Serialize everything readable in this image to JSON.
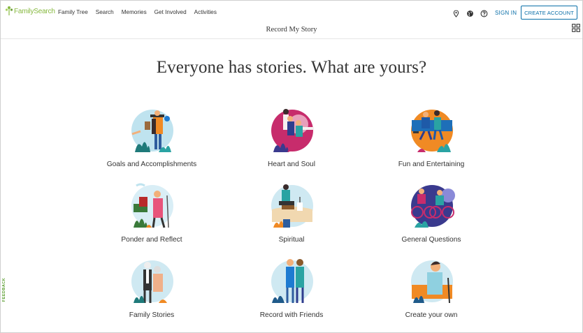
{
  "brand": {
    "name": "FamilySearch",
    "color": "#87b940"
  },
  "nav": [
    "Family Tree",
    "Search",
    "Memories",
    "Get Involved",
    "Activities"
  ],
  "header_icons": [
    "location-pin-icon",
    "globe-icon",
    "help-icon"
  ],
  "sign_in": "SIGN IN",
  "create_account": "CREATE ACCOUNT",
  "page_subtitle": "Record My Story",
  "headline": "Everyone has stories. What are yours?",
  "topics": [
    {
      "label": "Goals and Accomplishments",
      "icon": "goals-illustration"
    },
    {
      "label": "Heart and Soul",
      "icon": "heart-illustration"
    },
    {
      "label": "Fun and Entertaining",
      "icon": "fun-illustration"
    },
    {
      "label": "Ponder and Reflect",
      "icon": "ponder-illustration"
    },
    {
      "label": "Spiritual",
      "icon": "spiritual-illustration"
    },
    {
      "label": "General Questions",
      "icon": "questions-illustration"
    },
    {
      "label": "Family Stories",
      "icon": "family-illustration"
    },
    {
      "label": "Record with Friends",
      "icon": "friends-illustration"
    },
    {
      "label": "Create your own",
      "icon": "create-illustration"
    }
  ],
  "feedback": "FEEDBACK",
  "colors": {
    "link": "#0a6fa8",
    "accent_green": "#87b940",
    "teal": "#3aa6a6",
    "pink": "#d8327a",
    "orange": "#f08a24"
  }
}
